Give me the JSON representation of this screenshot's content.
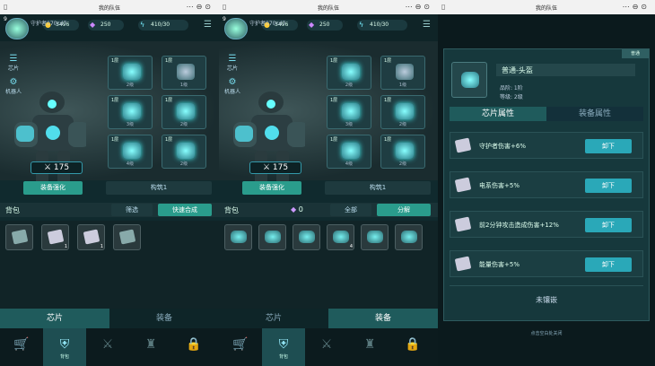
{
  "window_title": "我的队伍",
  "resources": {
    "level": "9",
    "gold": "3496",
    "gem": "250",
    "energy": "410/30",
    "username": "守护者070cd7"
  },
  "side": {
    "chip_label": "芯片",
    "robot_label": "机器人"
  },
  "power": "175",
  "slots_left": [
    {
      "layer": "1层",
      "level": "2级",
      "style": "glow"
    },
    {
      "layer": "1层",
      "level": "1级",
      "style": "dark"
    },
    {
      "layer": "1层",
      "level": "3级",
      "style": "glow"
    },
    {
      "layer": "1层",
      "level": "2级",
      "style": "glow"
    },
    {
      "layer": "1层",
      "level": "4级",
      "style": "glow"
    },
    {
      "layer": "1层",
      "level": "2级",
      "style": "glow"
    }
  ],
  "buttons": {
    "equip_enhance": "装备强化",
    "shortcut": "构筑1",
    "filter": "筛选",
    "fast_merge": "快速合成",
    "all": "全部",
    "decompose": "分解",
    "zero": "0"
  },
  "bag_label": "背包",
  "bag_chip_tags": [
    "",
    "1",
    "1",
    ""
  ],
  "bag_gear_tags": [
    "",
    "",
    "",
    "4",
    "",
    ""
  ],
  "tabs": {
    "chip": "芯片",
    "gear": "装备"
  },
  "nav": {
    "bag": "背包"
  },
  "popup": {
    "close": "普通",
    "title": "普通-头盔",
    "line1": "品阶: 1阶",
    "line2": "等级: 2级",
    "tab_chip": "芯片属性",
    "tab_gear": "装备属性",
    "rows": [
      {
        "text": "守护者伤害+6%",
        "btn": "卸下"
      },
      {
        "text": "电系伤害+5%",
        "btn": "卸下"
      },
      {
        "text": "前2分钟攻击造成伤害+12%",
        "btn": "卸下"
      },
      {
        "text": "能量伤害+5%",
        "btn": "卸下"
      }
    ],
    "locked": "未镶嵌",
    "tip": "点击空白处关闭"
  },
  "colors": {
    "accent": "#2a9c8c",
    "panel": "#102a2e",
    "button_cyan": "#2aa8b8"
  }
}
